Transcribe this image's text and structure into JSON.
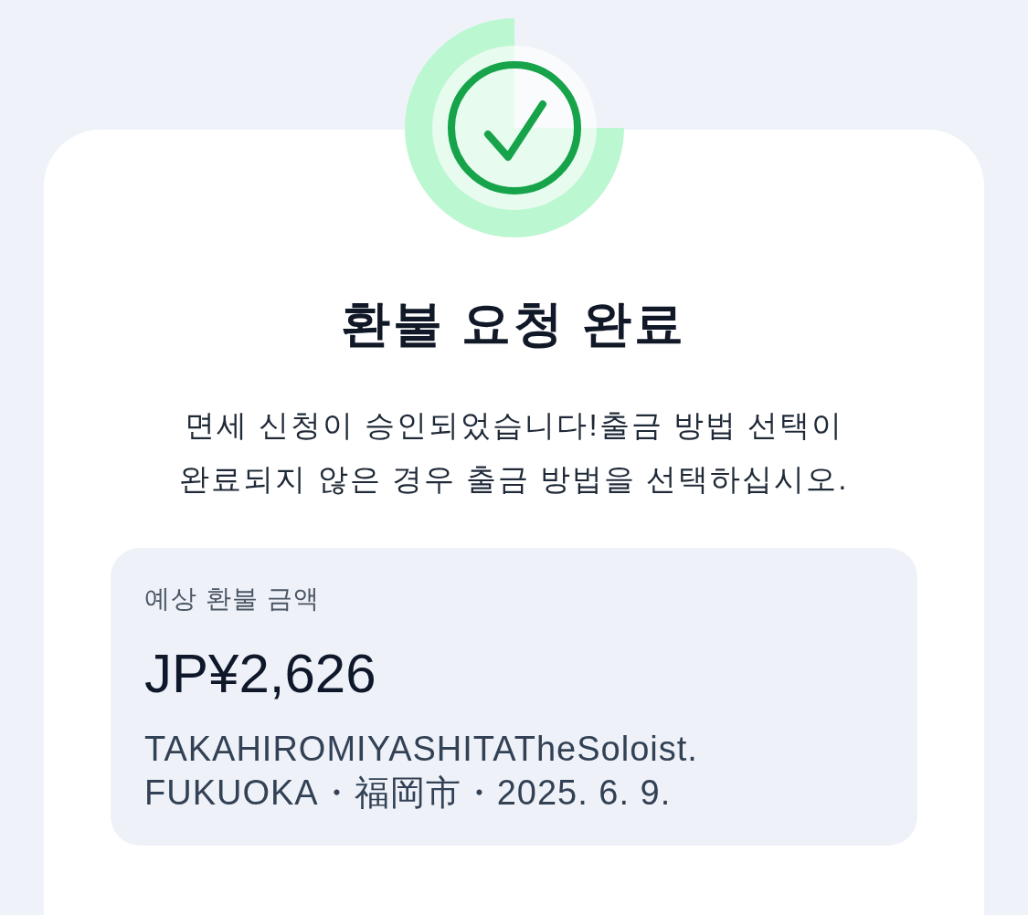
{
  "title": "환불 요청 완료",
  "message": "면세 신청이 승인되었습니다!출금 방법 선택이 완료되지 않은 경우 출금 방법을 선택하십시오.",
  "refund_summary": {
    "label": "예상 환불 금액",
    "amount": "JP¥2,626",
    "details": "TAKAHIROMIYASHITATheSoloist. FUKUOKA・福岡市・2025. 6. 9."
  }
}
